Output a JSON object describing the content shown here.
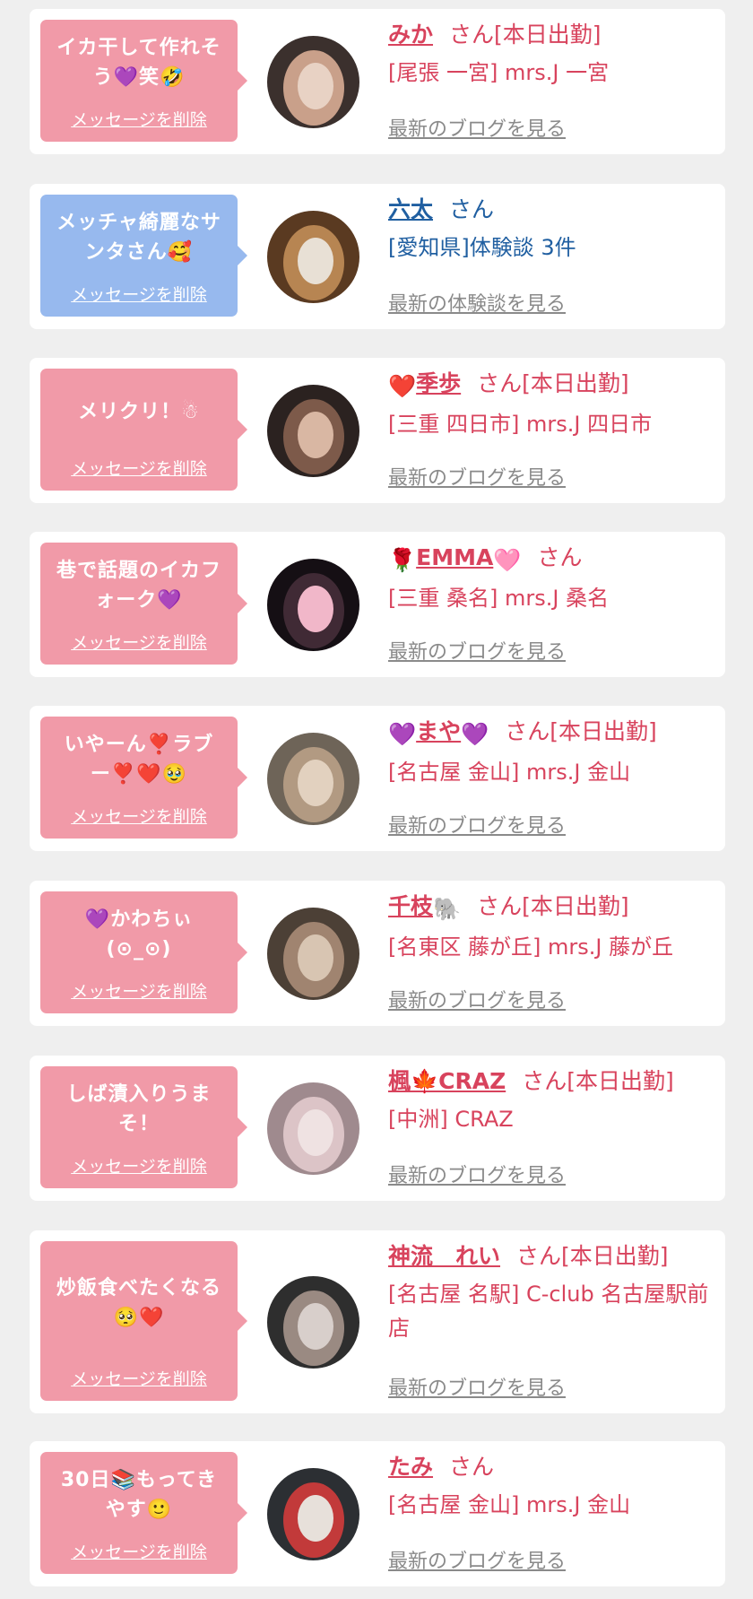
{
  "colors": {
    "bubble_pink": "#f19aa8",
    "bubble_blue": "#97b9ee",
    "name_red": "#d8435d",
    "name_navy": "#205fa1",
    "link_gray": "#8a8a8a",
    "background": "#efefef"
  },
  "delete_label": "メッセージを削除",
  "items": [
    {
      "message_lines": [
        "イカ干して作れそ",
        "う💜笑🤣"
      ],
      "name": "みか",
      "name_prefix_icon": "",
      "name_suffix_icon": "",
      "honorific": "さん[本日出勤]",
      "shop": "[尾張 一宮] mrs.J 一宮",
      "link": "最新のブログを見る",
      "avatar_icon": "woman-with-cat-photo"
    },
    {
      "message_lines": [
        "メッチャ綺麗なサ",
        "ンタさん🥰"
      ],
      "name": "六太",
      "name_prefix_icon": "",
      "name_suffix_icon": "",
      "honorific": "さん",
      "shop": "[愛知県]体験談 3件",
      "link": "最新の体験談を見る",
      "avatar_icon": "table-photo"
    },
    {
      "message_lines": [
        "メリクリ！☃"
      ],
      "name": "季歩",
      "name_prefix_icon": "❤️",
      "name_suffix_icon": "",
      "honorific": "さん[本日出勤]",
      "shop": "[三重 四日市] mrs.J 四日市",
      "link": "最新のブログを見る",
      "avatar_icon": "love-you-photo"
    },
    {
      "message_lines": [
        "巷で話題のイカフ",
        "ォーク💜"
      ],
      "name": "EMMA",
      "name_prefix_icon": "🌹",
      "name_suffix_icon": "🩷",
      "honorific": "さん",
      "shop": "[三重 桑名] mrs.J 桑名",
      "link": "最新のブログを見る",
      "avatar_icon": "emma-photo"
    },
    {
      "message_lines": [
        "いやーん❣️ラブ",
        "ー❣️❤️🥹"
      ],
      "name": "まや",
      "name_prefix_icon": "💜",
      "name_suffix_icon": "💜",
      "honorific": "さん[本日出勤]",
      "shop": "[名古屋 金山] mrs.J 金山",
      "link": "最新のブログを見る",
      "avatar_icon": "cafe-woman-photo"
    },
    {
      "message_lines": [
        "💜かわちぃ",
        "(⊙_⊙)"
      ],
      "name": "千枝",
      "name_prefix_icon": "",
      "name_suffix_icon": "🐘",
      "honorific": "さん[本日出勤]",
      "shop": "[名東区 藤が丘] mrs.J 藤が丘",
      "link": "最新のブログを見る",
      "avatar_icon": "bottle-woman-photo"
    },
    {
      "message_lines": [
        "しば漬入りうま",
        "そ！"
      ],
      "name": "楓🍁CRAZ",
      "name_prefix_icon": "",
      "name_suffix_icon": "",
      "honorific": "さん[本日出勤]",
      "shop": "[中洲] CRAZ",
      "link": "最新のブログを見る",
      "avatar_icon": "resting-woman-photo"
    },
    {
      "message_lines": [
        "炒飯食べたくなる",
        "🥺❤️"
      ],
      "name": "神流　れい",
      "name_prefix_icon": "",
      "name_suffix_icon": "",
      "honorific": "さん[本日出勤]",
      "shop": "[名古屋 名駅] C-club 名古屋駅前店",
      "link": "最新のブログを見る",
      "avatar_icon": "portrait-photo"
    },
    {
      "message_lines": [
        "30日📚もってき",
        "やす🙂"
      ],
      "name": "たみ",
      "name_prefix_icon": "",
      "name_suffix_icon": "",
      "honorific": "さん",
      "shop": "[名古屋 金山] mrs.J 金山",
      "link": "最新のブログを見る",
      "avatar_icon": "strawberry-photo"
    }
  ]
}
